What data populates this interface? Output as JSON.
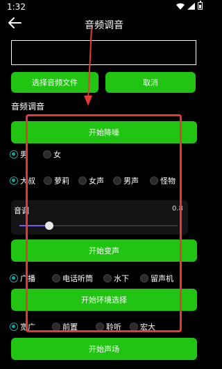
{
  "status_bar": {
    "time": "1:32",
    "icons": [
      "wifi-icon",
      "signal-icon",
      "battery-icon"
    ]
  },
  "header": {
    "title": "音频调音",
    "back_icon": "arrow-left-icon"
  },
  "file_picker": {
    "value": "",
    "choose_label": "选择音频文件",
    "cancel_label": "取消"
  },
  "section_title": "音频调音",
  "denoise": {
    "button_label": "开始降噪"
  },
  "gender": {
    "options": [
      "男",
      "女"
    ],
    "selected": 0
  },
  "voice_type": {
    "options": [
      "大叔",
      "萝莉",
      "女声",
      "男声",
      "怪物"
    ],
    "selected": 0
  },
  "pitch": {
    "label": "音调",
    "value": "0.8",
    "slider_fraction": 0.19
  },
  "voice_change": {
    "button_label": "开始变声"
  },
  "environment": {
    "options": [
      "广播",
      "电话听筒",
      "水下",
      "留声机"
    ],
    "selected": 0,
    "button_label": "开始环境选择"
  },
  "sound_field": {
    "options": [
      "宽广",
      "前置",
      "聆听",
      "宏大"
    ],
    "selected": 0,
    "button_label": "开始声场"
  },
  "colors": {
    "accent_green": "#22c414",
    "radio_selected": "#1aa39b",
    "slider_fill": "#7a5cf0",
    "annotation_red": "#e53935"
  }
}
